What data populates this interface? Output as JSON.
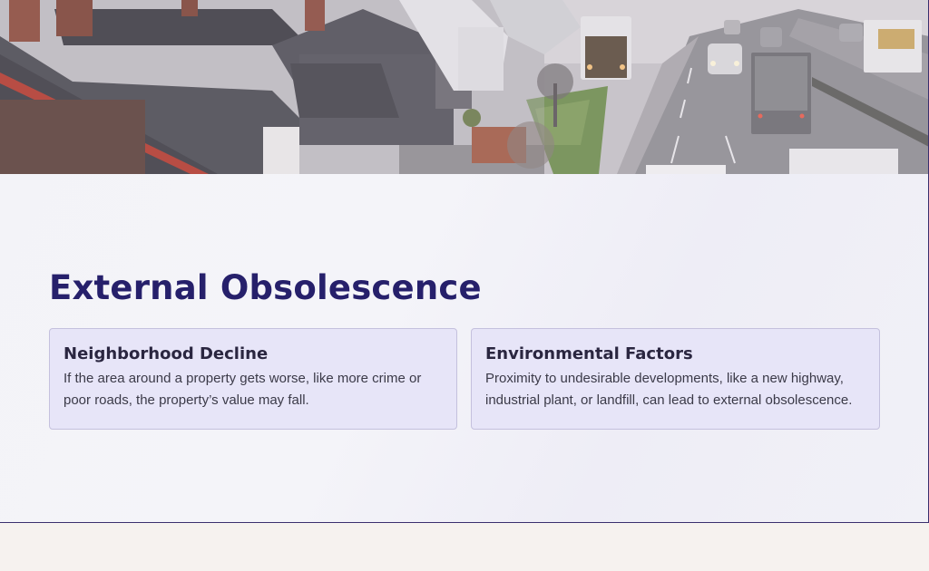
{
  "hero": {
    "scene": "suburban-houses-and-highway-photo"
  },
  "slide": {
    "title": "External Obsolescence"
  },
  "cards": [
    {
      "heading": "Neighborhood Decline",
      "body": "If the area around a property gets worse, like more crime or poor roads, the property’s value may fall."
    },
    {
      "heading": "Environmental Factors",
      "body": "Proximity to undesirable developments, like a new highway, industrial plant, or landfill, can lead to external obsolescence."
    }
  ],
  "colors": {
    "title": "#26206b",
    "card_bg": "#e7e5f8",
    "card_border": "#c4c0dd",
    "page_bg": "#f6f2ef"
  }
}
